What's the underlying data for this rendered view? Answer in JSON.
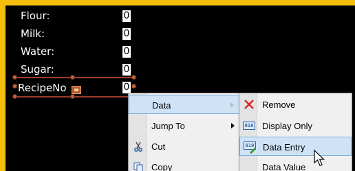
{
  "fields": [
    {
      "label": "Flour:",
      "value": "0"
    },
    {
      "label": "Milk:",
      "value": "0"
    },
    {
      "label": "Water:",
      "value": "0"
    },
    {
      "label": "Sugar:",
      "value": "0"
    },
    {
      "label": "RecipeNo",
      "value": "0"
    }
  ],
  "context_menu": {
    "items": [
      {
        "label": "Data",
        "has_submenu": true,
        "icon": ""
      },
      {
        "label": "Jump To",
        "has_submenu": true,
        "icon": ""
      },
      {
        "label": "Cut",
        "has_submenu": false,
        "icon": "scissors-icon"
      },
      {
        "label": "Copy",
        "has_submenu": false,
        "icon": "copy-icon"
      }
    ]
  },
  "submenu": {
    "items": [
      {
        "label": "Remove",
        "icon": "red-x-icon"
      },
      {
        "label": "Display Only",
        "icon": "display-only-icon",
        "icon_text": "010"
      },
      {
        "label": "Data Entry",
        "icon": "data-entry-icon",
        "icon_text": "010"
      },
      {
        "label": "Data Value",
        "icon": "data-value-icon"
      }
    ]
  },
  "colors": {
    "frame": "#f5bf0c",
    "canvas": "#000000",
    "highlight": "#cfe3f6",
    "selection": "#9c3b2e"
  }
}
